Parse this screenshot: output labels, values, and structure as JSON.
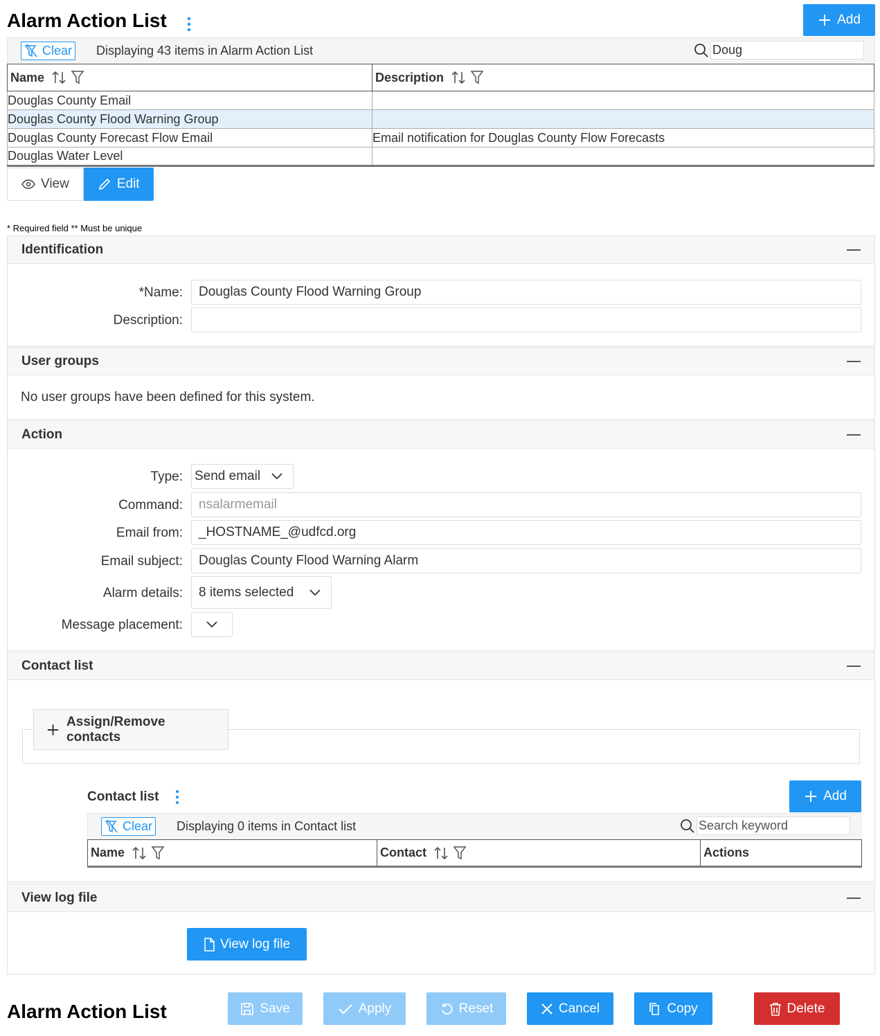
{
  "header": {
    "title": "Alarm Action List",
    "add_label": "Add"
  },
  "list_toolbar": {
    "clear_label": "Clear",
    "display_text": "Displaying 43 items in Alarm Action List",
    "search_value": "Doug"
  },
  "list_table": {
    "columns": [
      "Name",
      "Description"
    ],
    "rows": [
      {
        "name": "Douglas County Email",
        "description": ""
      },
      {
        "name": "Douglas County Flood Warning Group",
        "description": ""
      },
      {
        "name": "Douglas County Forecast Flow Email",
        "description": "Email notification for Douglas County Flow Forecasts"
      },
      {
        "name": "Douglas Water Level",
        "description": ""
      }
    ]
  },
  "mode": {
    "view_label": "View",
    "edit_label": "Edit"
  },
  "required_note": "* Required field ** Must be unique",
  "identification": {
    "title": "Identification",
    "name_label": "*Name:",
    "name_value": "Douglas County Flood Warning Group",
    "description_label": "Description:",
    "description_value": ""
  },
  "user_groups": {
    "title": "User groups",
    "message": "No user groups have been defined for this system."
  },
  "action": {
    "title": "Action",
    "type_label": "Type:",
    "type_value": "Send email",
    "command_label": "Command:",
    "command_value": "nsalarmemail",
    "email_from_label": "Email from:",
    "email_from_value": "_HOSTNAME_@udfcd.org",
    "email_subject_label": "Email subject:",
    "email_subject_value": "Douglas County Flood Warning Alarm",
    "alarm_details_label": "Alarm details:",
    "alarm_details_value": "8 items selected",
    "message_placement_label": "Message placement:",
    "message_placement_value": ""
  },
  "contact_panel": {
    "title": "Contact list",
    "assign_label": "Assign/Remove contacts",
    "sub_title": "Contact list",
    "add_label": "Add",
    "clear_label": "Clear",
    "display_text": "Displaying 0 items in Contact list",
    "search_placeholder": "Search keyword",
    "columns": [
      "Name",
      "Contact",
      "Actions"
    ]
  },
  "log_panel": {
    "title": "View log file",
    "button_label": "View log file"
  },
  "footer": {
    "title": "Alarm Action List",
    "save_label": "Save",
    "apply_label": "Apply",
    "reset_label": "Reset",
    "cancel_label": "Cancel",
    "copy_label": "Copy",
    "delete_label": "Delete"
  },
  "colors": {
    "primary": "#2196f3",
    "primary_disabled": "#90caf9",
    "danger": "#d32f2f",
    "selected_row": "#e3f0fc"
  }
}
